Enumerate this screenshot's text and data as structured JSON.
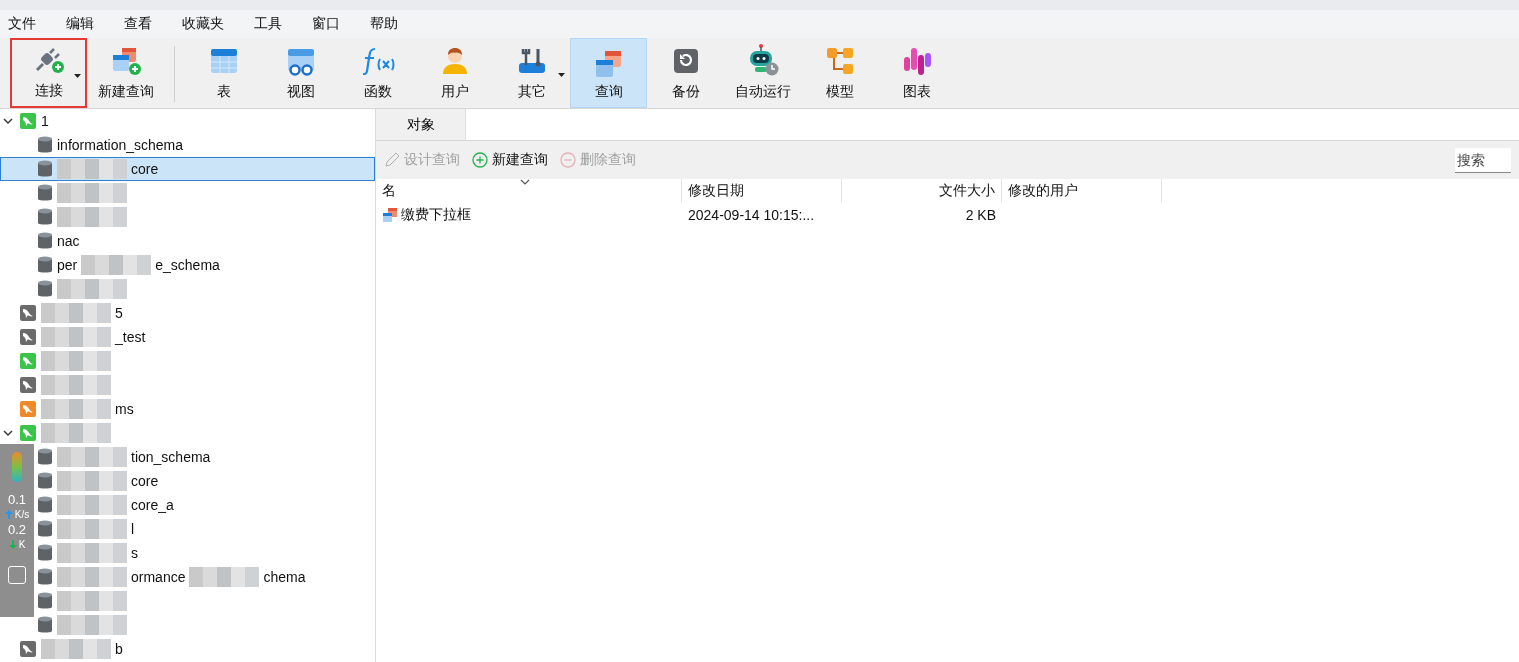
{
  "menu": [
    "文件",
    "编辑",
    "查看",
    "收藏夹",
    "工具",
    "窗口",
    "帮助"
  ],
  "toolbar": [
    {
      "kind": "connect",
      "label": "连接",
      "dropdown": true,
      "highlighted": true,
      "selected": false
    },
    {
      "kind": "new-query",
      "label": "新建查询",
      "dropdown": false,
      "highlighted": false,
      "selected": false
    },
    {
      "kind": "separator"
    },
    {
      "kind": "table",
      "label": "表",
      "dropdown": false,
      "highlighted": false,
      "selected": false
    },
    {
      "kind": "view",
      "label": "视图",
      "dropdown": false,
      "highlighted": false,
      "selected": false
    },
    {
      "kind": "function",
      "label": "函数",
      "dropdown": false,
      "highlighted": false,
      "selected": false
    },
    {
      "kind": "user",
      "label": "用户",
      "dropdown": false,
      "highlighted": false,
      "selected": false
    },
    {
      "kind": "tools",
      "label": "其它",
      "dropdown": true,
      "highlighted": false,
      "selected": false
    },
    {
      "kind": "query",
      "label": "查询",
      "dropdown": false,
      "highlighted": false,
      "selected": true
    },
    {
      "kind": "backup",
      "label": "备份",
      "dropdown": false,
      "highlighted": false,
      "selected": false
    },
    {
      "kind": "robot",
      "label": "自动运行",
      "dropdown": false,
      "highlighted": false,
      "selected": false
    },
    {
      "kind": "model",
      "label": "模型",
      "dropdown": false,
      "highlighted": false,
      "selected": false
    },
    {
      "kind": "chart",
      "label": "图表",
      "dropdown": false,
      "highlighted": false,
      "selected": false
    }
  ],
  "tree": [
    {
      "kind": "connection",
      "color": "#3cc34a",
      "parts": [
        "1"
      ],
      "redacted": false,
      "expanded": true,
      "selected": false,
      "children": [
        {
          "kind": "database",
          "parts": [
            "information_schema"
          ],
          "redacted": false,
          "selected": false
        },
        {
          "kind": "database",
          "parts": [
            "core"
          ],
          "redacted": true,
          "selected": true
        },
        {
          "kind": "database",
          "redacted": true,
          "selected": false
        },
        {
          "kind": "database",
          "redacted": true,
          "selected": false
        },
        {
          "kind": "database",
          "parts": [
            "nac"
          ],
          "redacted": false,
          "selected": false
        },
        {
          "kind": "database",
          "parts": [
            "per",
            "e_schema"
          ],
          "redacted": false,
          "selected": false
        },
        {
          "kind": "database",
          "redacted": true,
          "selected": false
        }
      ]
    },
    {
      "kind": "connection",
      "color": "#6b6b6b",
      "parts": [
        "5"
      ],
      "redacted": true,
      "expanded": false,
      "selected": false
    },
    {
      "kind": "connection",
      "color": "#6b6b6b",
      "parts": [
        "_test"
      ],
      "redacted": true,
      "expanded": false,
      "selected": false
    },
    {
      "kind": "connection",
      "color": "#3cc34a",
      "redacted": true,
      "expanded": false,
      "selected": false
    },
    {
      "kind": "connection",
      "color": "#6b6b6b",
      "redacted": true,
      "expanded": false,
      "selected": false
    },
    {
      "kind": "connection",
      "color": "#f0892a",
      "parts": [
        "ms"
      ],
      "redacted": true,
      "expanded": false,
      "selected": false
    },
    {
      "kind": "connection",
      "color": "#3cc34a",
      "redacted": true,
      "expanded": true,
      "selected": false,
      "children": [
        {
          "kind": "database",
          "parts": [
            "tion_schema"
          ],
          "redacted": true,
          "selected": false
        },
        {
          "kind": "database",
          "parts": [
            "core"
          ],
          "redacted": true,
          "selected": false
        },
        {
          "kind": "database",
          "parts": [
            "core_a"
          ],
          "redacted": true,
          "selected": false
        },
        {
          "kind": "database",
          "parts": [
            "l"
          ],
          "redacted": true,
          "selected": false
        },
        {
          "kind": "database",
          "parts": [
            "s"
          ],
          "redacted": true,
          "selected": false
        },
        {
          "kind": "database",
          "parts": [
            "ormance",
            "chema"
          ],
          "redacted": true,
          "selected": false
        },
        {
          "kind": "database",
          "redacted": true,
          "selected": false
        },
        {
          "kind": "database",
          "redacted": true,
          "selected": false
        }
      ]
    },
    {
      "kind": "connection",
      "color": "#6b6b6b",
      "parts": [
        "b"
      ],
      "redacted": true,
      "expanded": false,
      "selected": false
    }
  ],
  "monitor": {
    "upload": "0.1",
    "upload_unit": "K/s",
    "download": "0.2",
    "download_unit": "K"
  },
  "tabs": [
    {
      "label": "对象",
      "selected": true
    }
  ],
  "actions": [
    {
      "kind": "design",
      "label": "设计查询",
      "disabled": true
    },
    {
      "kind": "new",
      "label": "新建查询",
      "disabled": false
    },
    {
      "kind": "delete",
      "label": "删除查询",
      "disabled": true
    }
  ],
  "search": {
    "placeholder": "搜索"
  },
  "table": {
    "columns": [
      {
        "label": "名",
        "sorted": true
      },
      {
        "label": "修改日期",
        "sorted": false
      },
      {
        "label": "文件大小",
        "sorted": false
      },
      {
        "label": "修改的用户",
        "sorted": false
      }
    ],
    "rows": [
      [
        "缴费下拉框",
        "2024-09-14 10:15:...",
        "2 KB"
      ]
    ]
  }
}
